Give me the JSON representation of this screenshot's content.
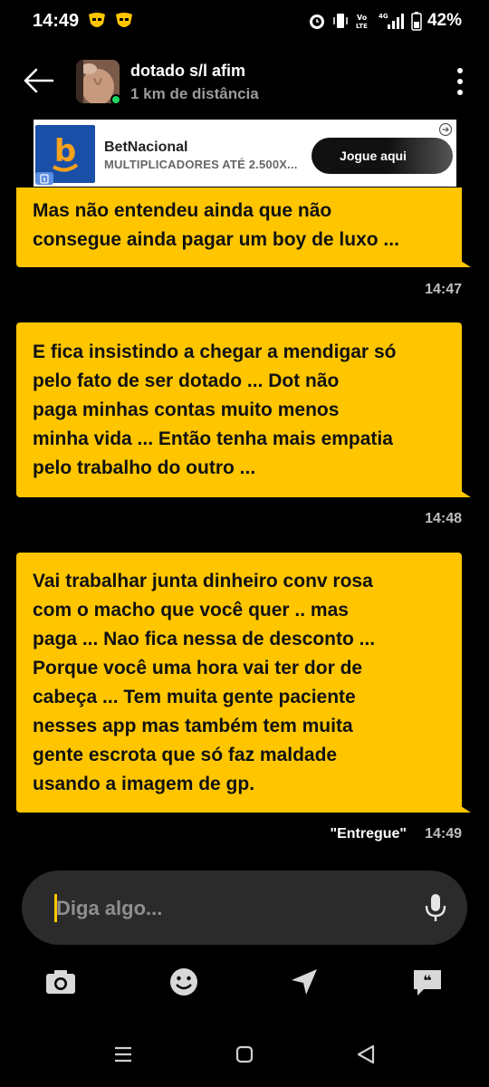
{
  "status_bar": {
    "time": "14:49",
    "battery": "42%",
    "network": "4G"
  },
  "header": {
    "name": "dotado s/l afim",
    "distance": "1 km de distância",
    "online_color": "#1ed760"
  },
  "ad": {
    "title": "BetNacional",
    "subtitle": "MULTIPLICADORES ATÉ 2.500X...",
    "button": "Jogue aqui",
    "logo_letter": "b"
  },
  "messages": [
    {
      "lines": [
        "Mas não entendeu ainda que  não",
        "consegue ainda pagar um boy de luxo ..."
      ],
      "time": "14:47"
    },
    {
      "lines": [
        "E fica insistindo a chegar a mendigar só",
        "pelo fato de ser dotado   ...  Dot não",
        "paga minhas contas  muito menos",
        "minha vida ... Então tenha mais empatia",
        "pelo trabalho do outro ..."
      ],
      "time": "14:48"
    },
    {
      "lines": [
        "Vai trabalhar junta dinheiro conv rosa",
        "com o macho que você quer .. mas",
        "paga ... Nao fica nessa de desconto ...",
        "Porque você  uma hora vai ter dor de",
        "cabeça ... Tem muita gente paciente",
        "nesses app mas também tem muita",
        "gente escrota que só faz maldade",
        "usando a imagem de gp."
      ],
      "time": "14:49",
      "status": "\"Entregue\""
    }
  ],
  "input": {
    "placeholder": "Diga algo..."
  },
  "colors": {
    "accent": "#ffc600",
    "background": "#000000",
    "input_bg": "#2b2b2b"
  },
  "icons": {
    "toolbar": [
      "camera-icon",
      "emoji-icon",
      "location-icon",
      "saved-phrases-icon"
    ],
    "nav": [
      "recent-apps-icon",
      "home-icon",
      "back-icon"
    ]
  }
}
